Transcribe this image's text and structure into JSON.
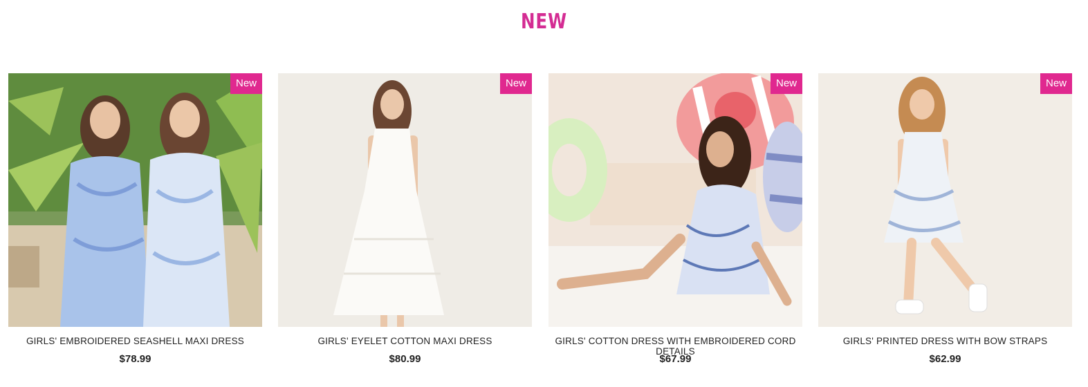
{
  "section": {
    "title": "NEW"
  },
  "products": [
    {
      "name": "GIRLS' EMBROIDERED SEASHELL MAXI DRESS",
      "price": "$78.99",
      "badge": "New"
    },
    {
      "name": "GIRLS' EYELET COTTON MAXI DRESS",
      "price": "$80.99",
      "badge": "New"
    },
    {
      "name": "GIRLS' COTTON DRESS WITH EMBROIDERED CORD DETAILS",
      "price": "$67.99",
      "badge": "New"
    },
    {
      "name": "GIRLS' PRINTED DRESS WITH BOW STRAPS",
      "price": "$62.99",
      "badge": "New"
    }
  ],
  "colors": {
    "accent": "#e0288f",
    "title": "#d42c93"
  }
}
